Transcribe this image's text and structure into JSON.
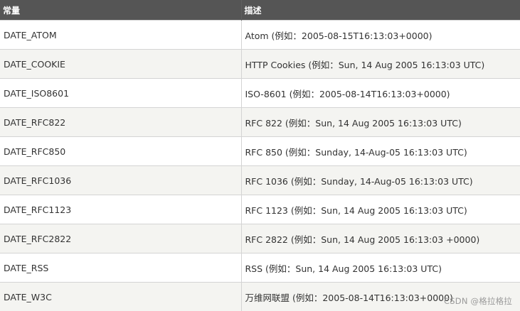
{
  "table": {
    "headers": [
      "常量",
      "描述"
    ],
    "rows": [
      {
        "constant": "DATE_ATOM",
        "description": "Atom (例如：2005-08-15T16:13:03+0000)"
      },
      {
        "constant": "DATE_COOKIE",
        "description": "HTTP Cookies (例如：Sun, 14 Aug 2005 16:13:03 UTC)"
      },
      {
        "constant": "DATE_ISO8601",
        "description": "ISO-8601 (例如：2005-08-14T16:13:03+0000)"
      },
      {
        "constant": "DATE_RFC822",
        "description": "RFC 822 (例如：Sun, 14 Aug 2005 16:13:03 UTC)"
      },
      {
        "constant": "DATE_RFC850",
        "description": "RFC 850 (例如：Sunday, 14-Aug-05 16:13:03 UTC)"
      },
      {
        "constant": "DATE_RFC1036",
        "description": "RFC 1036 (例如：Sunday, 14-Aug-05 16:13:03 UTC)"
      },
      {
        "constant": "DATE_RFC1123",
        "description": "RFC 1123 (例如：Sun, 14 Aug 2005 16:13:03 UTC)"
      },
      {
        "constant": "DATE_RFC2822",
        "description": "RFC 2822 (例如：Sun, 14 Aug 2005 16:13:03 +0000)"
      },
      {
        "constant": "DATE_RSS",
        "description": "RSS (例如：Sun, 14 Aug 2005 16:13:03 UTC)"
      },
      {
        "constant": "DATE_W3C",
        "description": "万维网联盟 (例如：2005-08-14T16:13:03+0000)"
      }
    ]
  },
  "watermark": "CSDN @格拉格拉",
  "colors": {
    "header_bg": "#555555",
    "header_text": "#ffffff",
    "row_alt_bg": "#f4f4f1",
    "cell_text": "#333333",
    "border": "#d4d4d4"
  }
}
